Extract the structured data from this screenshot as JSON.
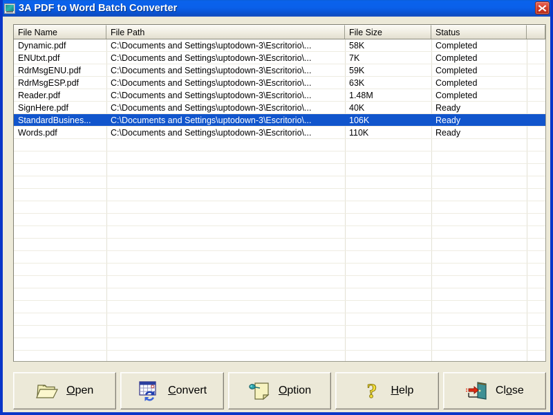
{
  "window": {
    "title": "3A PDF to Word Batch Converter",
    "app_icon": "pdf-converter-icon",
    "close_icon": "close-icon",
    "titlebar_color": "#0a60ea",
    "face_color": "#ece9d8",
    "selection_color": "#1155cc"
  },
  "list": {
    "columns": [
      {
        "key": "name",
        "label": "File Name"
      },
      {
        "key": "path",
        "label": "File Path"
      },
      {
        "key": "size",
        "label": "File Size"
      },
      {
        "key": "status",
        "label": "Status"
      },
      {
        "key": "extra",
        "label": ""
      }
    ],
    "rows": [
      {
        "name": "Dynamic.pdf",
        "path": "C:\\Documents and Settings\\uptodown-3\\Escritorio\\...",
        "size": "58K",
        "status": "Completed",
        "selected": false
      },
      {
        "name": "ENUtxt.pdf",
        "path": "C:\\Documents and Settings\\uptodown-3\\Escritorio\\...",
        "size": "7K",
        "status": "Completed",
        "selected": false
      },
      {
        "name": "RdrMsgENU.pdf",
        "path": "C:\\Documents and Settings\\uptodown-3\\Escritorio\\...",
        "size": "59K",
        "status": "Completed",
        "selected": false
      },
      {
        "name": "RdrMsgESP.pdf",
        "path": "C:\\Documents and Settings\\uptodown-3\\Escritorio\\...",
        "size": "63K",
        "status": "Completed",
        "selected": false
      },
      {
        "name": "Reader.pdf",
        "path": "C:\\Documents and Settings\\uptodown-3\\Escritorio\\...",
        "size": "1.48M",
        "status": "Completed",
        "selected": false
      },
      {
        "name": "SignHere.pdf",
        "path": "C:\\Documents and Settings\\uptodown-3\\Escritorio\\...",
        "size": "40K",
        "status": "Ready",
        "selected": false
      },
      {
        "name": "StandardBusines...",
        "path": "C:\\Documents and Settings\\uptodown-3\\Escritorio\\...",
        "size": "106K",
        "status": "Ready",
        "selected": true
      },
      {
        "name": "Words.pdf",
        "path": "C:\\Documents and Settings\\uptodown-3\\Escritorio\\...",
        "size": "110K",
        "status": "Ready",
        "selected": false
      }
    ]
  },
  "buttons": [
    {
      "id": "open",
      "label_before": "",
      "accel": "O",
      "label_after": "pen",
      "icon": "open-folder-icon"
    },
    {
      "id": "convert",
      "label_before": "",
      "accel": "C",
      "label_after": "onvert",
      "icon": "convert-icon"
    },
    {
      "id": "option",
      "label_before": "",
      "accel": "O",
      "label_after": "ption",
      "icon": "pushpin-note-icon"
    },
    {
      "id": "help",
      "label_before": "",
      "accel": "H",
      "label_after": "elp",
      "icon": "question-mark-icon"
    },
    {
      "id": "close",
      "label_before": "Cl",
      "accel": "o",
      "label_after": "se",
      "icon": "exit-door-icon"
    }
  ]
}
